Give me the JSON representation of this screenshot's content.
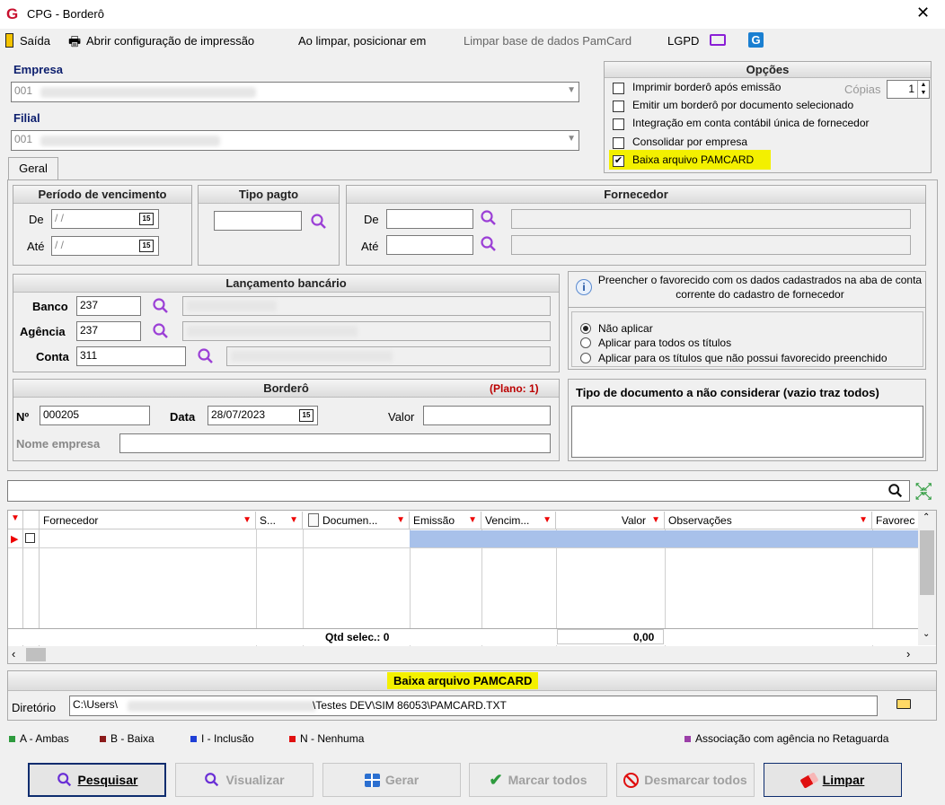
{
  "window": {
    "title": "CPG - Borderô"
  },
  "toolbar": {
    "saida": "Saída",
    "abrir": "Abrir configuração de impressão",
    "ao_limpar": "Ao limpar, posicionar em",
    "limpar_base": "Limpar base de dados PamCard",
    "lgpd": "LGPD"
  },
  "empresa": {
    "label": "Empresa",
    "value": "001"
  },
  "filial": {
    "label": "Filial",
    "value": "001"
  },
  "tab": {
    "geral": "Geral"
  },
  "opcoes": {
    "title": "Opções",
    "items": [
      "Imprimir borderô após emissão",
      "Emitir um borderô por documento selecionado",
      "Integração em conta contábil única de fornecedor",
      "Consolidar por empresa",
      "Baixa arquivo PAMCARD"
    ],
    "checked": [
      false,
      false,
      false,
      false,
      true
    ],
    "copias_label": "Cópias",
    "copias_value": "1"
  },
  "periodo": {
    "title": "Período de vencimento",
    "de": "De",
    "ate": "Até",
    "de_value": " / /",
    "ate_value": " / /"
  },
  "tipo_pagto": {
    "title": "Tipo pagto"
  },
  "fornecedor": {
    "title": "Fornecedor",
    "de": "De",
    "ate": "Até"
  },
  "lancamento": {
    "title": "Lançamento bancário",
    "banco_label": "Banco",
    "banco": "237",
    "agencia_label": "Agência",
    "agencia": "237",
    "conta_label": "Conta",
    "conta": "311"
  },
  "favorecido": {
    "info": "Preencher o favorecido com os dados cadastrados na aba de conta corrente do cadastro de fornecedor",
    "options": [
      "Não aplicar",
      "Aplicar para todos os títulos",
      "Aplicar para os títulos que não possui favorecido preenchido"
    ],
    "selected": 0
  },
  "bordero": {
    "title": "Borderô",
    "plano": "(Plano: 1)",
    "no_label": "Nº",
    "no": "000205",
    "data_label": "Data",
    "data": "28/07/2023",
    "valor_label": "Valor",
    "nome_label": "Nome empresa"
  },
  "tipo_doc": {
    "title": "Tipo de documento a não considerar (vazio traz todos)"
  },
  "grid": {
    "columns": [
      "Fornecedor",
      "S...",
      "Documen...",
      "Emissão",
      "Vencim...",
      "Valor",
      "Observações",
      "Favorec"
    ],
    "qtd": "Qtd selec.: 0",
    "total": "0,00"
  },
  "pamcard": {
    "title": "Baixa arquivo PAMCARD",
    "dir_label": "Diretório",
    "dir_prefix": "C:\\Users\\",
    "dir_suffix": "\\Testes DEV\\SIM 86053\\PAMCARD.TXT"
  },
  "legend": {
    "a": "A - Ambas",
    "b": "B - Baixa",
    "i": "I - Inclusão",
    "n": "N - Nenhuma",
    "assoc": "Associação com agência no Retaguarda",
    "colors": {
      "a": "#2e9b3e",
      "b": "#8b1a1a",
      "i": "#1f3fd6",
      "n": "#e01010",
      "assoc": "#9b3fa8"
    }
  },
  "buttons": {
    "pesquisar": "Pesquisar",
    "visualizar": "Visualizar",
    "gerar": "Gerar",
    "marcar": "Marcar todos",
    "desmarcar": "Desmarcar todos",
    "limpar": "Limpar"
  }
}
